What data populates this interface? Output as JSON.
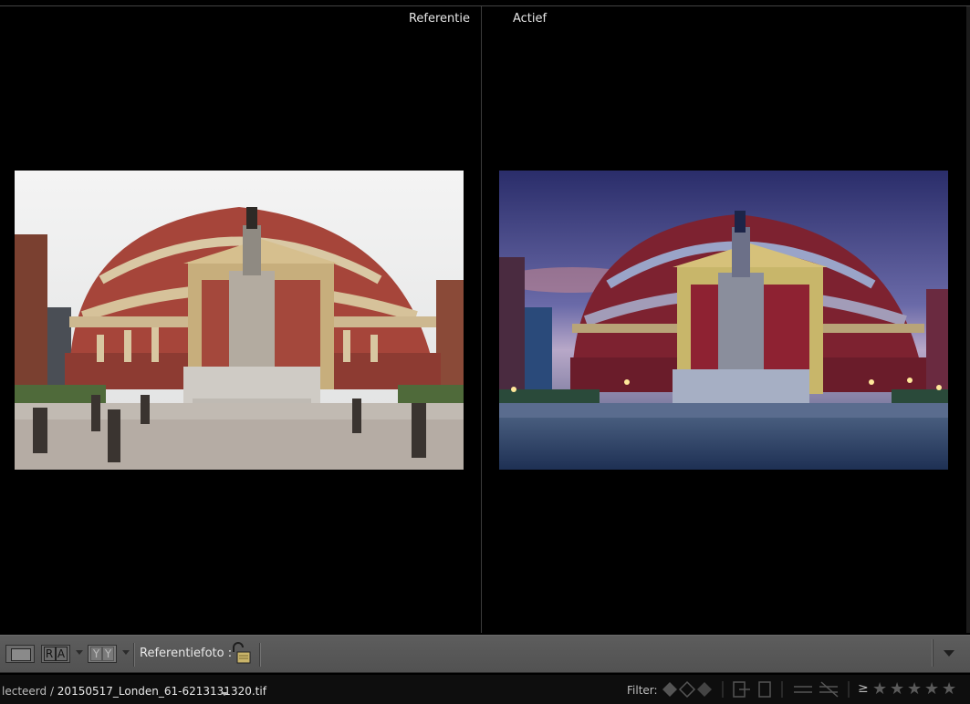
{
  "views": {
    "reference_label": "Referentie",
    "active_label": "Actief"
  },
  "toolbar": {
    "view_single": "single-view",
    "ra_label": [
      "R",
      "A"
    ],
    "yy_label": [
      "Y",
      "Y"
    ],
    "reference_photo_label": "Referentiefoto :"
  },
  "status": {
    "path_prefix": "lecteerd / ",
    "filename": "20150517_Londen_61-6213131320.tif",
    "filter_label": "Filter:",
    "rating_operator": "≥"
  },
  "colors": {
    "toolbar": "#585858",
    "background": "#000000",
    "status_bar": "#0e0e0e"
  }
}
